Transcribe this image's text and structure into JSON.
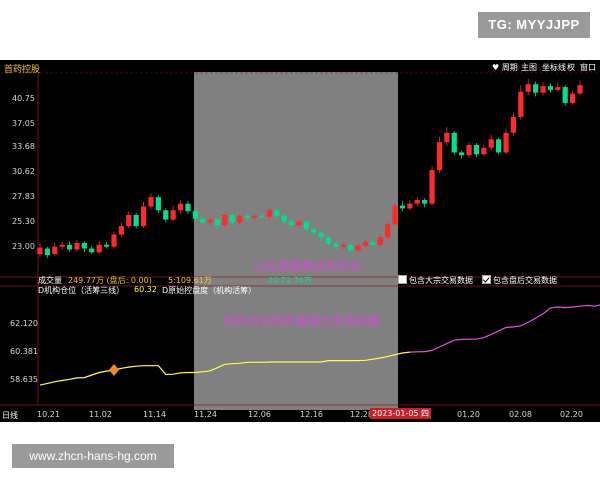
{
  "badge": "TG: MYYJJPP",
  "watermark": "www.zhcn-hans-hg.com",
  "header": {
    "title": "首药控股",
    "toolbar": [
      "♥ 周期",
      "主图",
      "坐标线",
      "权",
      "窗口"
    ]
  },
  "price_axis": [
    "40.75",
    "37.05",
    "33.68",
    "30.62",
    "27.83",
    "25.30",
    "23.00"
  ],
  "volume_row": {
    "label": "成交量",
    "value": "249.77万 (盘后: 0.00)",
    "s_ma": "5:109.61万",
    "s_ma2": "20:72.76万",
    "opt1": "包含大宗交易数据",
    "opt2": "包含盘后交易数据"
  },
  "indicator_row": {
    "item1": "D机构仓位（活筹三线）",
    "val1": "60.32",
    "item2": "D原始控盘度（机构活筹）"
  },
  "indicator_axis": [
    "62.120",
    "60.381",
    "58.635"
  ],
  "x_axis": {
    "corner": "日线",
    "dates": [
      "10.21",
      "11.02",
      "11.14",
      "11.24",
      "12.06",
      "12.16",
      "12.28",
      "01.20",
      "02.08",
      "02.20"
    ],
    "highlight_date": "2023-01-05",
    "highlight_suffix": "四"
  },
  "annotations": {
    "upper": "山谷里面看机构仓位",
    "lower": "机构仓位低控盘增仓至高控盘"
  },
  "colors": {
    "up": "#ff2a2a",
    "down": "#00e08a",
    "line_low": "#ffff44",
    "line_high": "#e052e0",
    "annotation": "#d64ad6",
    "highlight_band": "#808080"
  },
  "chart_data": {
    "type": "candlestick",
    "y_ticks": [
      40.75,
      37.05,
      33.68,
      30.62,
      27.83,
      25.3,
      23.0
    ],
    "ylim": [
      21.5,
      42.5
    ],
    "candles": [
      {
        "o": 23.2,
        "c": 23.9,
        "h": 24.3,
        "l": 22.9
      },
      {
        "o": 23.8,
        "c": 23.1,
        "h": 24.0,
        "l": 22.8
      },
      {
        "o": 23.2,
        "c": 24.0,
        "h": 24.4,
        "l": 23.0
      },
      {
        "o": 24.0,
        "c": 24.2,
        "h": 24.5,
        "l": 23.7
      },
      {
        "o": 24.2,
        "c": 23.7,
        "h": 24.6,
        "l": 23.5
      },
      {
        "o": 23.7,
        "c": 24.4,
        "h": 24.7,
        "l": 23.5
      },
      {
        "o": 24.4,
        "c": 23.8,
        "h": 24.6,
        "l": 23.4
      },
      {
        "o": 23.8,
        "c": 23.4,
        "h": 24.1,
        "l": 23.2
      },
      {
        "o": 23.4,
        "c": 24.2,
        "h": 24.6,
        "l": 23.2
      },
      {
        "o": 24.2,
        "c": 24.0,
        "h": 24.5,
        "l": 23.8
      },
      {
        "o": 24.0,
        "c": 25.3,
        "h": 25.6,
        "l": 23.8
      },
      {
        "o": 25.3,
        "c": 26.2,
        "h": 26.6,
        "l": 25.0
      },
      {
        "o": 26.2,
        "c": 27.4,
        "h": 27.8,
        "l": 26.0
      },
      {
        "o": 27.4,
        "c": 26.2,
        "h": 27.6,
        "l": 25.9
      },
      {
        "o": 26.2,
        "c": 28.3,
        "h": 28.8,
        "l": 26.0
      },
      {
        "o": 28.3,
        "c": 29.3,
        "h": 29.7,
        "l": 28.0
      },
      {
        "o": 29.3,
        "c": 27.9,
        "h": 29.5,
        "l": 27.6
      },
      {
        "o": 27.9,
        "c": 26.9,
        "h": 28.1,
        "l": 26.6
      },
      {
        "o": 26.9,
        "c": 27.9,
        "h": 28.4,
        "l": 26.7
      },
      {
        "o": 27.9,
        "c": 28.6,
        "h": 29.0,
        "l": 27.6
      },
      {
        "o": 28.6,
        "c": 27.8,
        "h": 28.9,
        "l": 27.5
      },
      {
        "o": 27.8,
        "c": 27.0,
        "h": 28.0,
        "l": 26.7
      },
      {
        "o": 27.0,
        "c": 26.6,
        "h": 27.2,
        "l": 26.3
      },
      {
        "o": 26.6,
        "c": 26.9,
        "h": 27.1,
        "l": 26.3
      },
      {
        "o": 26.9,
        "c": 26.3,
        "h": 27.1,
        "l": 26.0
      },
      {
        "o": 26.3,
        "c": 27.4,
        "h": 27.7,
        "l": 26.1
      },
      {
        "o": 27.4,
        "c": 26.6,
        "h": 27.6,
        "l": 26.3
      },
      {
        "o": 26.6,
        "c": 27.3,
        "h": 27.5,
        "l": 26.4
      },
      {
        "o": 27.3,
        "c": 27.1,
        "h": 27.6,
        "l": 26.7
      },
      {
        "o": 27.1,
        "c": 27.3,
        "h": 27.5,
        "l": 26.8
      },
      {
        "o": 27.3,
        "c": 27.2,
        "h": 27.5,
        "l": 26.9
      },
      {
        "o": 27.2,
        "c": 27.9,
        "h": 28.1,
        "l": 26.9
      },
      {
        "o": 27.9,
        "c": 27.3,
        "h": 28.1,
        "l": 27.0
      },
      {
        "o": 27.3,
        "c": 26.7,
        "h": 27.5,
        "l": 26.4
      },
      {
        "o": 26.7,
        "c": 26.3,
        "h": 26.9,
        "l": 26.0
      },
      {
        "o": 26.3,
        "c": 26.7,
        "h": 26.9,
        "l": 26.0
      },
      {
        "o": 26.7,
        "c": 25.9,
        "h": 26.8,
        "l": 25.6
      },
      {
        "o": 25.9,
        "c": 25.5,
        "h": 26.1,
        "l": 25.2
      },
      {
        "o": 25.5,
        "c": 25.0,
        "h": 25.6,
        "l": 24.6
      },
      {
        "o": 25.0,
        "c": 24.3,
        "h": 25.2,
        "l": 24.1
      },
      {
        "o": 24.3,
        "c": 24.0,
        "h": 24.5,
        "l": 23.8
      },
      {
        "o": 24.0,
        "c": 24.2,
        "h": 24.4,
        "l": 23.7
      },
      {
        "o": 24.2,
        "c": 23.6,
        "h": 24.3,
        "l": 23.4
      },
      {
        "o": 23.6,
        "c": 24.1,
        "h": 24.3,
        "l": 23.4
      },
      {
        "o": 24.1,
        "c": 24.5,
        "h": 24.7,
        "l": 23.9
      },
      {
        "o": 24.5,
        "c": 24.2,
        "h": 24.8,
        "l": 24.0
      },
      {
        "o": 24.2,
        "c": 25.0,
        "h": 25.2,
        "l": 24.0
      },
      {
        "o": 25.0,
        "c": 26.4,
        "h": 26.7,
        "l": 24.8
      },
      {
        "o": 26.4,
        "c": 28.4,
        "h": 28.7,
        "l": 26.2
      },
      {
        "o": 28.4,
        "c": 28.1,
        "h": 28.9,
        "l": 27.8
      },
      {
        "o": 28.1,
        "c": 28.6,
        "h": 29.0,
        "l": 27.9
      },
      {
        "o": 28.6,
        "c": 29.0,
        "h": 29.3,
        "l": 28.3
      },
      {
        "o": 29.0,
        "c": 28.6,
        "h": 29.2,
        "l": 28.2
      },
      {
        "o": 28.6,
        "c": 32.2,
        "h": 32.6,
        "l": 28.4
      },
      {
        "o": 32.2,
        "c": 35.2,
        "h": 35.8,
        "l": 31.9
      },
      {
        "o": 35.2,
        "c": 36.2,
        "h": 36.8,
        "l": 34.8
      },
      {
        "o": 36.2,
        "c": 34.1,
        "h": 36.4,
        "l": 33.8
      },
      {
        "o": 34.1,
        "c": 33.8,
        "h": 34.3,
        "l": 33.4
      },
      {
        "o": 33.8,
        "c": 34.9,
        "h": 35.2,
        "l": 33.5
      },
      {
        "o": 34.9,
        "c": 33.9,
        "h": 35.1,
        "l": 33.6
      },
      {
        "o": 33.9,
        "c": 34.6,
        "h": 34.9,
        "l": 33.7
      },
      {
        "o": 34.6,
        "c": 35.5,
        "h": 36.0,
        "l": 34.3
      },
      {
        "o": 35.5,
        "c": 34.1,
        "h": 35.7,
        "l": 33.9
      },
      {
        "o": 34.1,
        "c": 36.2,
        "h": 36.6,
        "l": 33.9
      },
      {
        "o": 36.2,
        "c": 37.9,
        "h": 38.4,
        "l": 35.9
      },
      {
        "o": 37.9,
        "c": 40.6,
        "h": 41.3,
        "l": 37.6
      },
      {
        "o": 40.6,
        "c": 41.4,
        "h": 42.0,
        "l": 40.2
      },
      {
        "o": 41.4,
        "c": 40.5,
        "h": 41.7,
        "l": 40.1
      },
      {
        "o": 40.5,
        "c": 41.2,
        "h": 41.6,
        "l": 40.2
      },
      {
        "o": 41.2,
        "c": 40.8,
        "h": 41.5,
        "l": 40.5
      },
      {
        "o": 40.8,
        "c": 41.1,
        "h": 41.6,
        "l": 40.6
      },
      {
        "o": 41.1,
        "c": 39.4,
        "h": 41.3,
        "l": 39.1
      },
      {
        "o": 39.4,
        "c": 40.4,
        "h": 40.7,
        "l": 39.2
      },
      {
        "o": 40.4,
        "c": 41.3,
        "h": 41.8,
        "l": 40.2
      }
    ],
    "indicator": {
      "ylim": [
        57.6,
        63.6
      ],
      "y_ticks": [
        62.12,
        60.381,
        58.635
      ],
      "series": [
        58.36,
        58.46,
        58.56,
        58.63,
        58.7,
        58.78,
        58.8,
        58.95,
        59.1,
        59.18,
        59.25,
        59.35,
        59.42,
        59.47,
        59.5,
        59.5,
        59.5,
        58.98,
        59.0,
        59.08,
        59.1,
        59.1,
        59.14,
        59.2,
        59.38,
        59.58,
        59.62,
        59.64,
        59.7,
        59.7,
        59.7,
        59.72,
        59.72,
        59.72,
        59.72,
        59.72,
        59.72,
        59.72,
        59.72,
        59.8,
        59.8,
        59.8,
        59.8,
        59.8,
        59.82,
        59.88,
        59.95,
        60.05,
        60.15,
        60.25,
        60.3,
        60.32,
        60.33,
        60.4,
        60.6,
        60.8,
        61.0,
        61.05,
        61.06,
        61.06,
        61.15,
        61.35,
        61.55,
        61.75,
        61.78,
        61.85,
        62.05,
        62.3,
        62.55,
        62.9,
        62.95,
        62.92,
        62.95,
        63.0,
        63.05,
        63.0,
        63.1,
        63.15,
        63.2,
        63.25
      ]
    }
  }
}
